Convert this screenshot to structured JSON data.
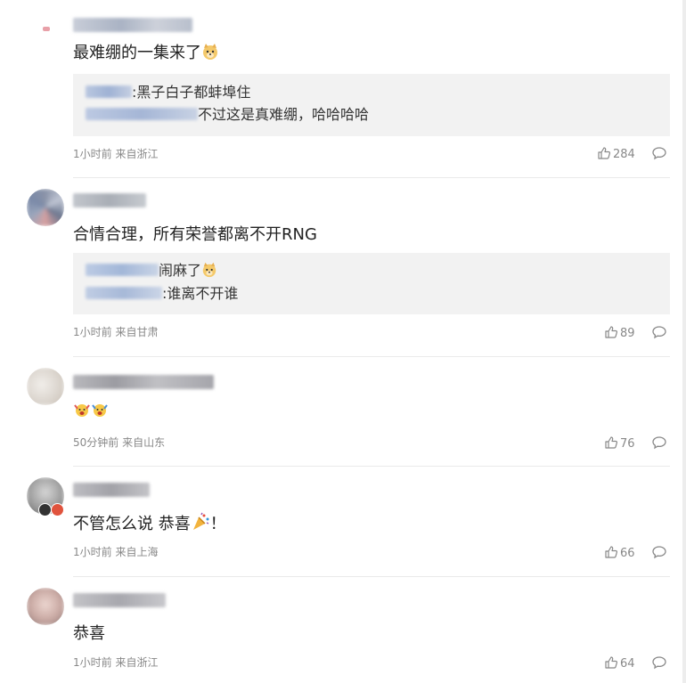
{
  "comments": [
    {
      "text": "最难绷的一集来了",
      "meta": "1小时前 来自浙江",
      "likes": "284",
      "replies": [
        {
          "text": ":黑子白子都蚌埠住"
        },
        {
          "text": "不过这是真难绷，哈哈哈哈"
        }
      ]
    },
    {
      "text": "合情合理，所有荣誉都离不开RNG",
      "meta": "1小时前 来自甘肃",
      "likes": "89",
      "replies": [
        {
          "text": "闹麻了"
        },
        {
          "text": ":谁离不开谁"
        }
      ]
    },
    {
      "text": "",
      "meta": "50分钟前 来自山东",
      "likes": "76",
      "replies": []
    },
    {
      "text": "不管怎么说 恭喜",
      "text_suffix": "！",
      "meta": "1小时前 来自上海",
      "likes": "66",
      "replies": []
    },
    {
      "text": "恭喜",
      "meta": "1小时前 来自浙江",
      "likes": "64",
      "replies": []
    }
  ],
  "icons": {
    "like": "thumbs-up-icon",
    "reply": "comment-bubble-icon",
    "emoji_doge": "doge-emoji-icon",
    "emoji_party": "party-popper-emoji-icon",
    "emoji_cheer": "cheering-emoji-icon"
  },
  "colors": {
    "meta_text": "#888888",
    "reply_bg": "#f2f2f2",
    "divider": "#eaeaea"
  }
}
